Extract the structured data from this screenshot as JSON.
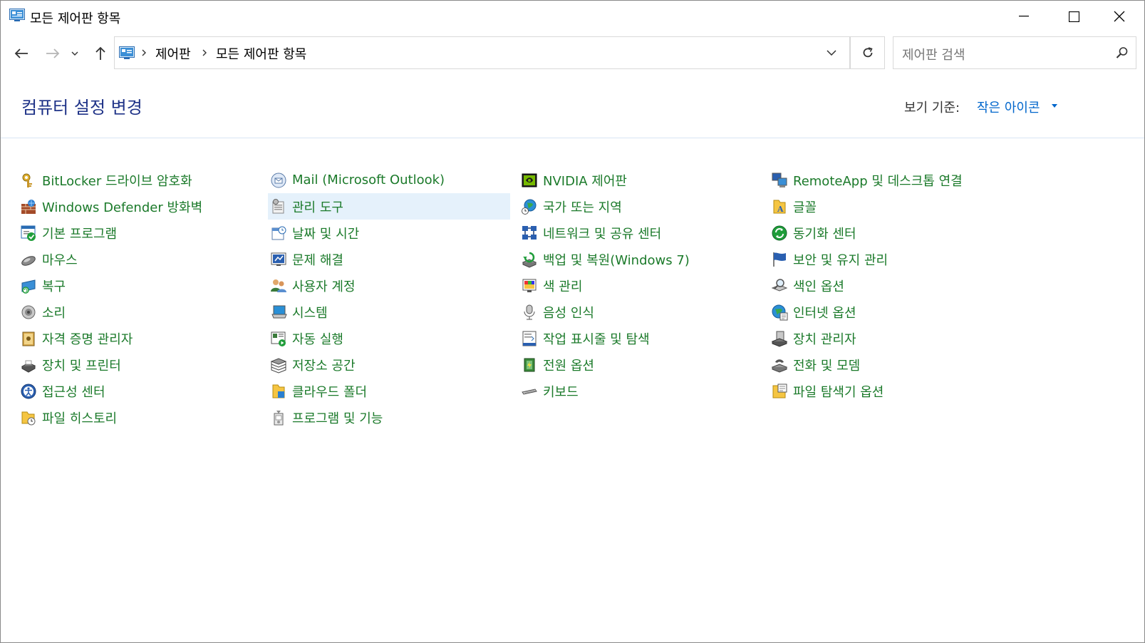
{
  "window": {
    "title": "모든 제어판 항목"
  },
  "address": {
    "crumbs": [
      "제어판",
      "모든 제어판 항목"
    ]
  },
  "search": {
    "placeholder": "제어판 검색"
  },
  "header": {
    "title": "컴퓨터 설정 변경",
    "view_label": "보기 기준:",
    "view_value": "작은 아이콘"
  },
  "colors": {
    "title_blue": "#1e3287",
    "link_green": "#1b7a2a",
    "link_blue": "#0066cc",
    "selection": "#e5f1fb"
  },
  "items": {
    "col1": [
      {
        "label": "BitLocker 드라이브 암호화",
        "icon": "bitlocker-icon"
      },
      {
        "label": "Windows Defender 방화벽",
        "icon": "firewall-icon"
      },
      {
        "label": "기본 프로그램",
        "icon": "default-programs-icon"
      },
      {
        "label": "마우스",
        "icon": "mouse-icon"
      },
      {
        "label": "복구",
        "icon": "recovery-icon"
      },
      {
        "label": "소리",
        "icon": "sound-icon"
      },
      {
        "label": "자격 증명 관리자",
        "icon": "credential-manager-icon"
      },
      {
        "label": "장치 및 프린터",
        "icon": "devices-printers-icon"
      },
      {
        "label": "접근성 센터",
        "icon": "ease-of-access-icon"
      },
      {
        "label": "파일 히스토리",
        "icon": "file-history-icon"
      }
    ],
    "col2": [
      {
        "label": "Mail (Microsoft Outlook)",
        "icon": "mail-icon"
      },
      {
        "label": "관리 도구",
        "icon": "admin-tools-icon"
      },
      {
        "label": "날짜 및 시간",
        "icon": "date-time-icon"
      },
      {
        "label": "문제 해결",
        "icon": "troubleshooting-icon"
      },
      {
        "label": "사용자 계정",
        "icon": "user-accounts-icon"
      },
      {
        "label": "시스템",
        "icon": "system-icon"
      },
      {
        "label": "자동 실행",
        "icon": "autoplay-icon"
      },
      {
        "label": "저장소 공간",
        "icon": "storage-spaces-icon"
      },
      {
        "label": "클라우드 폴더",
        "icon": "cloud-folder-icon"
      },
      {
        "label": "프로그램 및 기능",
        "icon": "programs-features-icon"
      }
    ],
    "col3": [
      {
        "label": "NVIDIA 제어판",
        "icon": "nvidia-icon"
      },
      {
        "label": "국가 또는 지역",
        "icon": "region-icon"
      },
      {
        "label": "네트워크 및 공유 센터",
        "icon": "network-icon"
      },
      {
        "label": "백업 및 복원(Windows 7)",
        "icon": "backup-icon"
      },
      {
        "label": "색 관리",
        "icon": "color-management-icon"
      },
      {
        "label": "음성 인식",
        "icon": "speech-icon"
      },
      {
        "label": "작업 표시줄 및 탐색",
        "icon": "taskbar-icon"
      },
      {
        "label": "전원 옵션",
        "icon": "power-icon"
      },
      {
        "label": "키보드",
        "icon": "keyboard-icon"
      }
    ],
    "col4": [
      {
        "label": "RemoteApp 및 데스크톱 연결",
        "icon": "remoteapp-icon"
      },
      {
        "label": "글꼴",
        "icon": "fonts-icon"
      },
      {
        "label": "동기화 센터",
        "icon": "sync-center-icon"
      },
      {
        "label": "보안 및 유지 관리",
        "icon": "security-maintenance-icon"
      },
      {
        "label": "색인 옵션",
        "icon": "indexing-icon"
      },
      {
        "label": "인터넷 옵션",
        "icon": "internet-options-icon"
      },
      {
        "label": "장치 관리자",
        "icon": "device-manager-icon"
      },
      {
        "label": "전화 및 모뎀",
        "icon": "phone-modem-icon"
      },
      {
        "label": "파일 탐색기 옵션",
        "icon": "explorer-options-icon"
      }
    ]
  }
}
